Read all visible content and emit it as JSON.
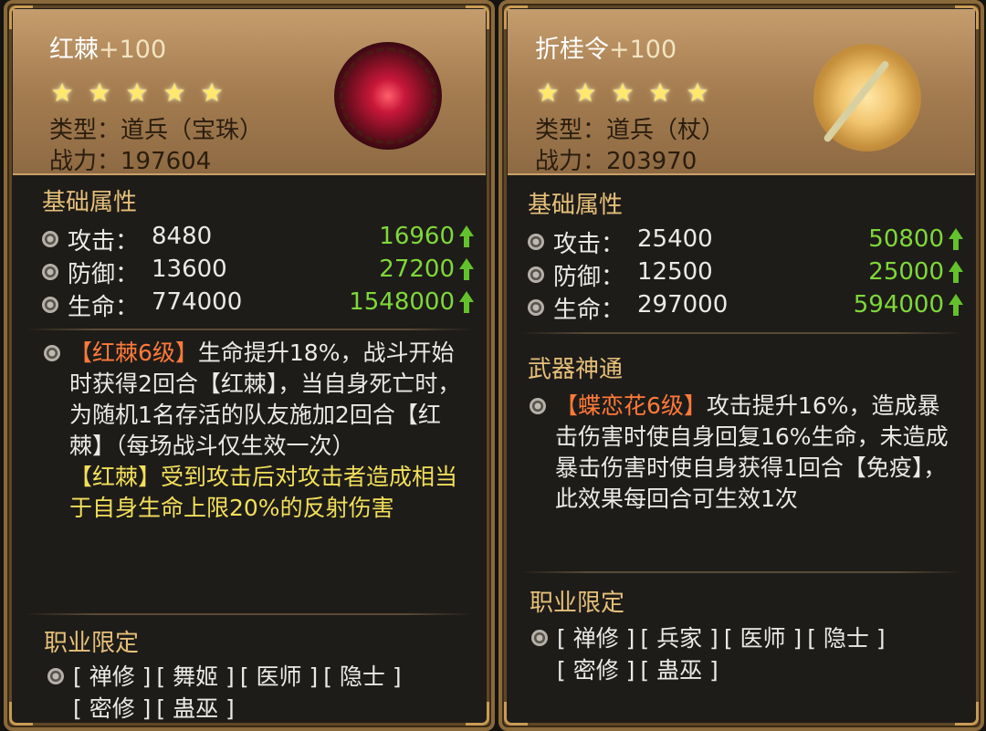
{
  "left_card": {
    "name": "红棘",
    "plus": "+100",
    "stars": 5,
    "type_label": "类型：",
    "type_value": "道兵（宝珠）",
    "power_label": "战力：",
    "power_value": "197604",
    "base_section": "基础属性",
    "stats": [
      {
        "label": "攻击：",
        "value": "8480",
        "boosted": "16960"
      },
      {
        "label": "防御：",
        "value": "13600",
        "boosted": "27200"
      },
      {
        "label": "生命：",
        "value": "774000",
        "boosted": "1548000"
      }
    ],
    "skill": {
      "tag": "【红棘6级】",
      "text1": "生命提升18%，战斗开始时获得2回合【红棘】，当自身死亡时，为随机1名存活的队友施加2回合【红棘】（每场战斗仅生效一次）",
      "text2": "【红棘】受到攻击后对攻击者造成相当于自身生命上限20%的反射伤害"
    },
    "job_section": "职业限定",
    "jobs": [
      "[ 禅修 ]",
      "[ 舞姬 ]",
      "[ 医师 ]",
      "[ 隐士 ]",
      "[ 密修 ]",
      "[ 蛊巫 ]"
    ]
  },
  "right_card": {
    "name": "折桂令",
    "plus": "+100",
    "stars": 5,
    "type_label": "类型：",
    "type_value": "道兵（杖）",
    "power_label": "战力：",
    "power_value": "203970",
    "base_section": "基础属性",
    "stats": [
      {
        "label": "攻击：",
        "value": "25400",
        "boosted": "50800"
      },
      {
        "label": "防御：",
        "value": "12500",
        "boosted": "25000"
      },
      {
        "label": "生命：",
        "value": "297000",
        "boosted": "594000"
      }
    ],
    "weapon_section": "武器神通",
    "skill": {
      "tag": "【蝶恋花6级】",
      "text1": "攻击提升16%，造成暴击伤害时使自身回复16%生命，未造成暴击伤害时使自身获得1回合【免疫】，此效果每回合可生效1次"
    },
    "job_section": "职业限定",
    "jobs": [
      "[ 禅修 ]",
      "[ 兵家 ]",
      "[ 医师 ]",
      "[ 隐士 ]",
      "[ 密修 ]",
      "[ 蛊巫 ]"
    ]
  },
  "colors": {
    "gold_title": "#e6c07a",
    "green_value": "#7fd83a",
    "skill_tag": "#ff7a3a",
    "yellow_text": "#f2df5a"
  },
  "icons": {
    "star": "star-icon",
    "bullet": "orb-bullet-icon",
    "arrow": "up-arrow-icon"
  }
}
